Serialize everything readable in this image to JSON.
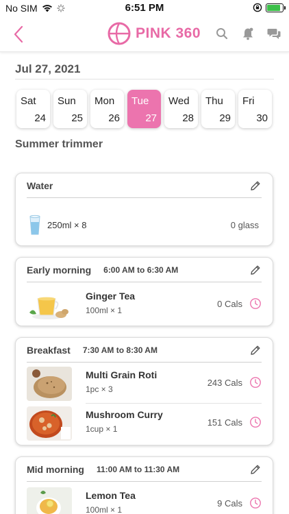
{
  "status": {
    "carrier": "No SIM",
    "time": "6:51 PM"
  },
  "header": {
    "logo_text": "PINK 360"
  },
  "date_title": "Jul 27, 2021",
  "days": [
    {
      "name": "Sat",
      "num": "24",
      "active": false
    },
    {
      "name": "Sun",
      "num": "25",
      "active": false
    },
    {
      "name": "Mon",
      "num": "26",
      "active": false
    },
    {
      "name": "Tue",
      "num": "27",
      "active": true
    },
    {
      "name": "Wed",
      "num": "28",
      "active": false
    },
    {
      "name": "Thu",
      "num": "29",
      "active": false
    },
    {
      "name": "Fri",
      "num": "30",
      "active": false
    }
  ],
  "plan_title": "Summer trimmer",
  "water": {
    "title": "Water",
    "amount": "250ml × 8",
    "count": "0 glass"
  },
  "meals": [
    {
      "title": "Early morning",
      "time": "6:00 AM to 6:30 AM",
      "items": [
        {
          "name": "Ginger Tea",
          "qty": "100ml × 1",
          "cals": "0 Cals",
          "image": "ginger-tea"
        }
      ]
    },
    {
      "title": "Breakfast",
      "time": "7:30 AM to 8:30 AM",
      "items": [
        {
          "name": "Multi Grain Roti",
          "qty": "1pc × 3",
          "cals": "243 Cals",
          "image": "roti"
        },
        {
          "name": "Mushroom Curry",
          "qty": "1cup × 1",
          "cals": "151 Cals",
          "image": "curry"
        }
      ]
    },
    {
      "title": "Mid morning",
      "time": "11:00 AM to 11:30 AM",
      "items": [
        {
          "name": "Lemon Tea",
          "qty": "100ml × 1",
          "cals": "9 Cals",
          "image": "lemon-tea"
        }
      ]
    }
  ],
  "colors": {
    "accent": "#ec74ae",
    "brand": "#e86aa6"
  }
}
